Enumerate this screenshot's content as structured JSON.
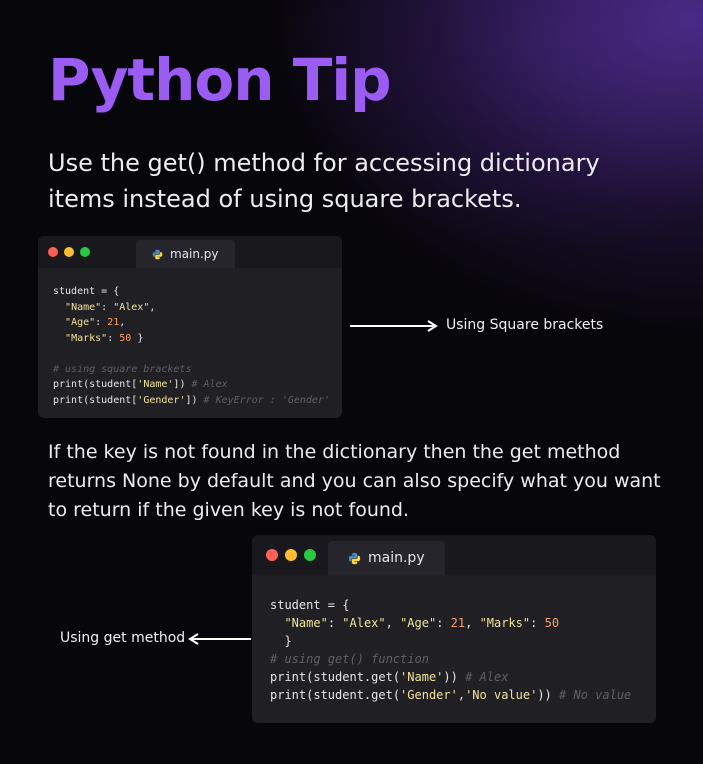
{
  "title": "Python Tip",
  "intro": "Use the get() method for accessing dictionary items instead of using square brackets.",
  "paragraph": "If the key is not found in the dictionary then the get method returns None by default and you can also specify what you want to return if the given key is not found.",
  "colors": {
    "accent": "#9a5cf2",
    "window_bg": "#1f1f24",
    "dot_red": "#ff5f57",
    "dot_yellow": "#febc2e",
    "dot_green": "#28c840",
    "string": "#f2e39a",
    "number": "#ff9e64",
    "comment": "#5f5f68"
  },
  "window1": {
    "tab_label": "main.py",
    "tab_icon": "python-icon",
    "code": {
      "line1": "student = {",
      "line2_key1": "\"Name\"",
      "line2_val1": "\"Alex\"",
      "line3_key2": "\"Age\"",
      "line3_val2": "21",
      "line4_key3": "\"Marks\"",
      "line4_val3": "50",
      "comment1": "# using square brackets",
      "call1_a": "print(student[",
      "call1_arg": "'Name'",
      "call1_b": "])",
      "call1_comment": "# Alex",
      "call2_a": "print(student[",
      "call2_arg": "'Gender'",
      "call2_b": "])",
      "call2_comment": "# KeyError : 'Gender'"
    }
  },
  "annotation1": "Using Square brackets",
  "window2": {
    "tab_label": "main.py",
    "tab_icon": "python-icon",
    "code": {
      "line1": "student = {",
      "key1": "\"Name\"",
      "val1": "\"Alex\"",
      "key2": "\"Age\"",
      "val2": "21",
      "key3": "\"Marks\"",
      "val3": "50",
      "close": "}",
      "comment1": "# using get() function",
      "call1_a": "print(student.get(",
      "call1_arg": "'Name'",
      "call1_b": "))",
      "call1_comment": "# Alex",
      "call2_a": "print(student.get(",
      "call2_arg1": "'Gender'",
      "call2_sep": ",",
      "call2_arg2": "'No value'",
      "call2_b": "))",
      "call2_comment": "# No value"
    }
  },
  "annotation2": "Using get method"
}
